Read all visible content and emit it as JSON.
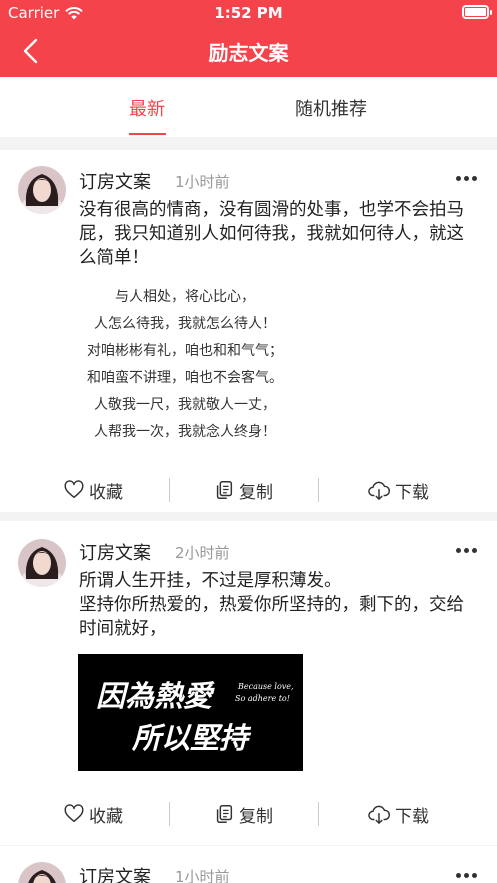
{
  "status_bar": {
    "carrier": "Carrier",
    "time": "1:52 PM"
  },
  "nav": {
    "title": "励志文案"
  },
  "tabs": [
    {
      "label": "最新",
      "active": true
    },
    {
      "label": "随机推荐",
      "active": false
    }
  ],
  "actions": {
    "favorite": "收藏",
    "copy": "复制",
    "download": "下载"
  },
  "posts": [
    {
      "author": "订房文案",
      "time_ago": "1小时前",
      "text": "没有很高的情商，没有圆滑的处事，也学不会拍马屁，我只知道别人如何待我，我就如何待人，就这么简单！",
      "poem_lines": [
        "与人相处，将心比心，",
        "人怎么待我，我就怎么待人！",
        "对咱彬彬有礼，咱也和和气气；",
        "和咱蛮不讲理，咱也不会客气。",
        "人敬我一尺，我就敬人一丈，",
        "人帮我一次，我就念人终身！"
      ]
    },
    {
      "author": "订房文案",
      "time_ago": "2小时前",
      "text_line1": "所谓人生开挂，不过是厚积薄发。",
      "text_line2": "坚持你所热爱的，热爱你所坚持的，剩下的，交给时间就好，",
      "image_text_line1": "因為熱愛",
      "image_text_line2": "所以堅持",
      "image_caption_line1": "Because love,",
      "image_caption_line2": "So adhere to!"
    },
    {
      "author": "订房文案",
      "time_ago": "1小时前"
    }
  ],
  "colors": {
    "accent": "#f4434b"
  }
}
